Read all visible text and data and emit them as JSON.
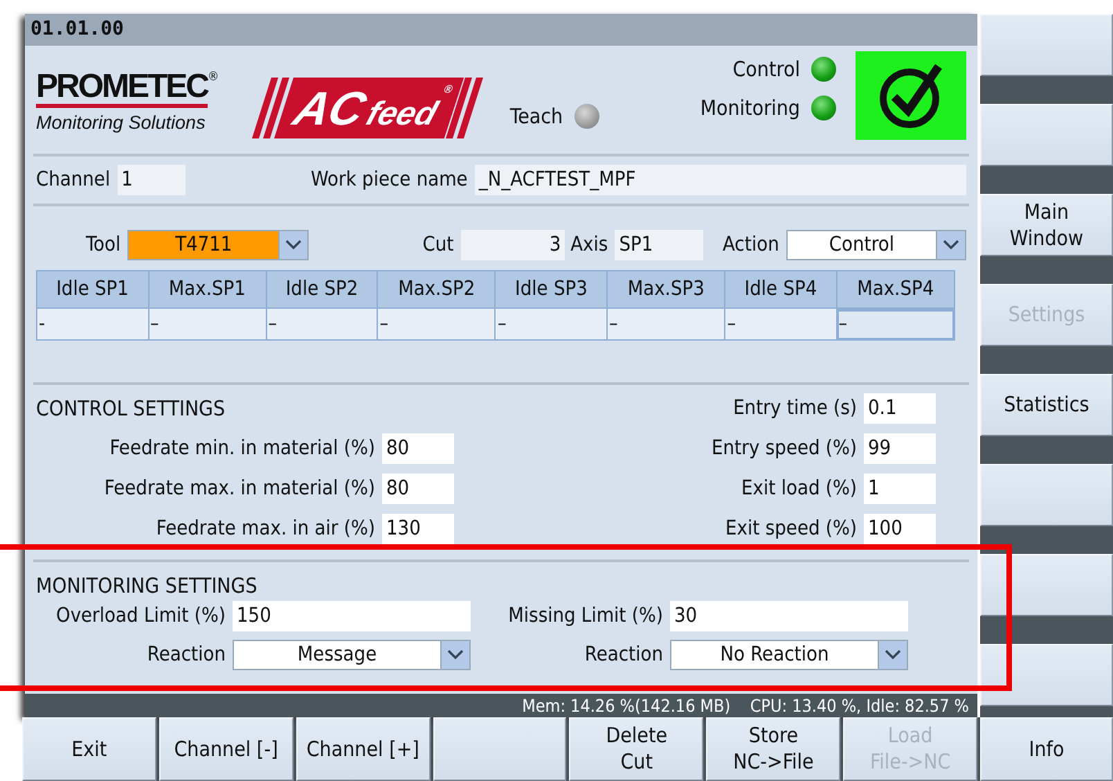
{
  "window": {
    "title": "01.01.00"
  },
  "header": {
    "logo": {
      "name": "PROMETEC",
      "mark": "®",
      "tagline": "Monitoring Solutions"
    },
    "product": {
      "name": "AC",
      "suffix": "feed",
      "mark": "®"
    },
    "indicators": [
      {
        "label": "Teach",
        "on": false
      },
      {
        "label": "Control",
        "on": true
      },
      {
        "label": "Monitoring",
        "on": true
      }
    ],
    "status_ok": true
  },
  "info_row": [
    {
      "label": "Channel",
      "value": "1"
    },
    {
      "label": "Work piece name",
      "value": "_N_ACFTEST_MPF"
    }
  ],
  "tool_row": {
    "tool": {
      "label": "Tool",
      "value": "T4711",
      "color": "#ff9900"
    },
    "cut": {
      "label": "Cut",
      "value": "3"
    },
    "axis": {
      "label": "Axis",
      "value": "SP1"
    },
    "action": {
      "label": "Action",
      "value": "Control"
    }
  },
  "table": {
    "columns": [
      "Idle SP1",
      "Max.SP1",
      "Idle SP2",
      "Max.SP2",
      "Idle SP3",
      "Max.SP3",
      "Idle SP4",
      "Max.SP4"
    ],
    "rows": [
      {
        "cells": [
          {
            "text": "-",
            "selected": false
          },
          {
            "text": "–",
            "selected": false
          },
          {
            "text": "–",
            "selected": false
          },
          {
            "text": "–",
            "selected": false
          },
          {
            "text": "–",
            "selected": false
          },
          {
            "text": "–",
            "selected": false
          },
          {
            "text": "–",
            "selected": false
          },
          {
            "text": "–",
            "selected": true
          }
        ]
      }
    ]
  },
  "control_settings": {
    "title": "CONTROL SETTINGS",
    "left": [
      {
        "label": "Feedrate min. in material (%)",
        "value": "80"
      },
      {
        "label": "Feedrate max. in material (%)",
        "value": "80"
      },
      {
        "label": "Feedrate max. in air (%)",
        "value": "130"
      }
    ],
    "right": [
      {
        "label": "Entry time (s)",
        "value": "0.1"
      },
      {
        "label": "Entry speed (%)",
        "value": "99"
      },
      {
        "label": "Exit load (%)",
        "value": "1"
      },
      {
        "label": "Exit speed (%)",
        "value": "100"
      }
    ]
  },
  "monitoring_settings": {
    "title": "MONITORING SETTINGS",
    "columns": [
      {
        "limit_label": "Overload Limit (%)",
        "limit_value": "150",
        "reaction_label": "Reaction",
        "reaction_value": "Message"
      },
      {
        "limit_label": "Missing Limit (%)",
        "limit_value": "30",
        "reaction_label": "Reaction",
        "reaction_value": "No Reaction"
      }
    ]
  },
  "status_bar": "Mem: 14.26 %(142.16 MB)    CPU: 13.40 %, Idle: 82.57 %",
  "vertical_softkeys": [
    {
      "kind": "blank"
    },
    {
      "kind": "blank"
    },
    {
      "kind": "labeled",
      "label": "Main\nWindow",
      "disabled": false
    },
    {
      "kind": "labeled",
      "label": "Settings",
      "disabled": true
    },
    {
      "kind": "labeled",
      "label": "Statistics",
      "disabled": false
    },
    {
      "kind": "blank"
    },
    {
      "kind": "blank"
    },
    {
      "kind": "blank"
    }
  ],
  "horizontal_softkeys": [
    {
      "kind": "labeled",
      "label": "Exit",
      "disabled": false
    },
    {
      "kind": "labeled",
      "label": "Channel [-]",
      "disabled": false
    },
    {
      "kind": "labeled",
      "label": "Channel [+]",
      "disabled": false
    },
    {
      "kind": "blank"
    },
    {
      "kind": "labeled",
      "label": "Delete\nCut",
      "disabled": false
    },
    {
      "kind": "labeled",
      "label": "Store\nNC->File",
      "disabled": false
    },
    {
      "kind": "labeled",
      "label": "Load\nFile->NC",
      "disabled": true
    },
    {
      "kind": "labeled",
      "label": "Info",
      "disabled": false
    }
  ]
}
